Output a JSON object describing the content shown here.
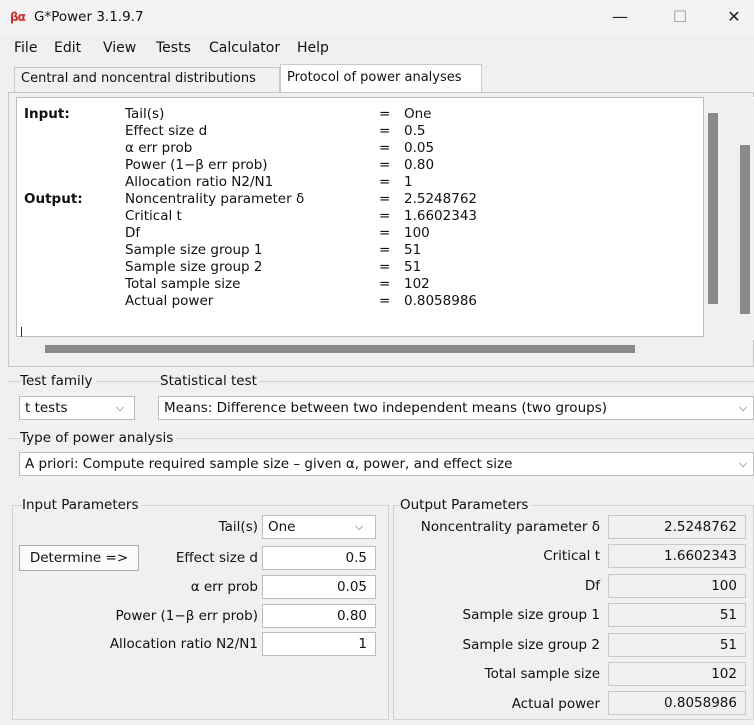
{
  "window": {
    "title": "G*Power 3.1.9.7",
    "icon_text": "βα",
    "minimize": "—",
    "maximize": "☐",
    "close": "✕"
  },
  "menu": [
    "File",
    "Edit",
    "View",
    "Tests",
    "Calculator",
    "Help"
  ],
  "tabs": [
    "Central and noncentral distributions",
    "Protocol of power analyses"
  ],
  "protocol": {
    "input_label": "Input:",
    "output_label": "Output:",
    "lines": [
      {
        "label": "Tail(s)",
        "eq": "=",
        "value": "One"
      },
      {
        "label": "Effect size d",
        "eq": "=",
        "value": "0.5"
      },
      {
        "label": "α err prob",
        "eq": "=",
        "value": "0.05"
      },
      {
        "label": "Power (1−β err prob)",
        "eq": "=",
        "value": "0.80"
      },
      {
        "label": "Allocation ratio N2/N1",
        "eq": "=",
        "value": "1"
      },
      {
        "label": "Noncentrality parameter δ",
        "eq": "=",
        "value": "2.5248762"
      },
      {
        "label": "Critical t",
        "eq": "=",
        "value": "1.6602343"
      },
      {
        "label": "Df",
        "eq": "=",
        "value": "100"
      },
      {
        "label": "Sample size group 1",
        "eq": "=",
        "value": "51"
      },
      {
        "label": "Sample size group 2",
        "eq": "=",
        "value": "51"
      },
      {
        "label": "Total sample size",
        "eq": "=",
        "value": "102"
      },
      {
        "label": "Actual power",
        "eq": "=",
        "value": "0.8058986"
      }
    ]
  },
  "test_family": {
    "label": "Test family",
    "value": "t tests"
  },
  "statistical_test": {
    "label": "Statistical test",
    "value": "Means: Difference between two independent means (two groups)"
  },
  "power_analysis": {
    "label": "Type of power analysis",
    "value": "A priori: Compute required sample size – given α, power, and effect size"
  },
  "input_params": {
    "title": "Input Parameters",
    "tails_label": "Tail(s)",
    "tails_value": "One",
    "determine_button": "Determine =>",
    "effect_size_label": "Effect size d",
    "effect_size_value": "0.5",
    "alpha_label": "α err prob",
    "alpha_value": "0.05",
    "power_label": "Power (1−β err prob)",
    "power_value": "0.80",
    "allocation_label": "Allocation ratio N2/N1",
    "allocation_value": "1"
  },
  "output_params": {
    "title": "Output Parameters",
    "rows": [
      {
        "label": "Noncentrality parameter δ",
        "value": "2.5248762"
      },
      {
        "label": "Critical t",
        "value": "1.6602343"
      },
      {
        "label": "Df",
        "value": "100"
      },
      {
        "label": "Sample size group 1",
        "value": "51"
      },
      {
        "label": "Sample size group 2",
        "value": "51"
      },
      {
        "label": "Total sample size",
        "value": "102"
      },
      {
        "label": "Actual power",
        "value": "0.8058986"
      }
    ]
  }
}
